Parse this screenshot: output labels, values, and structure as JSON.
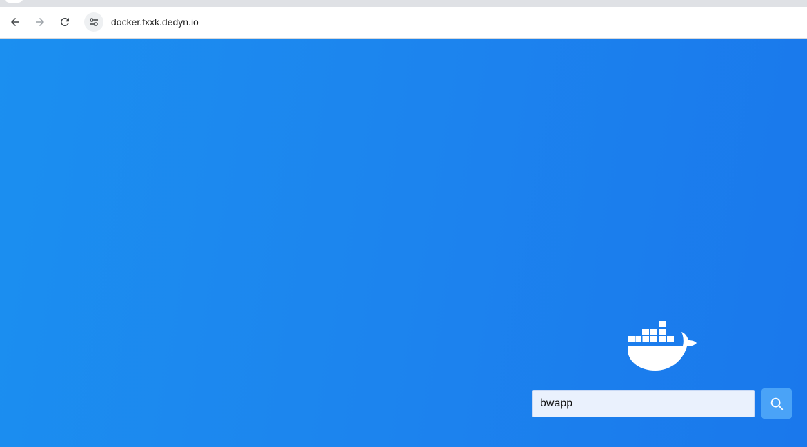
{
  "browser": {
    "address_bar": {
      "url": "docker.fxxk.dedyn.io"
    },
    "icons": {
      "back": "arrow-left-icon",
      "forward": "arrow-right-icon",
      "reload": "reload-icon",
      "site_info": "tune-icon"
    }
  },
  "page": {
    "logo": "docker-whale-icon",
    "search": {
      "value": "bwapp",
      "button_icon": "search-icon"
    },
    "colors": {
      "background_start": "#1b8ff0",
      "background_end": "#1a78ec",
      "search_button": "#4aa3f7",
      "input_bg": "#eaf1fd"
    }
  }
}
